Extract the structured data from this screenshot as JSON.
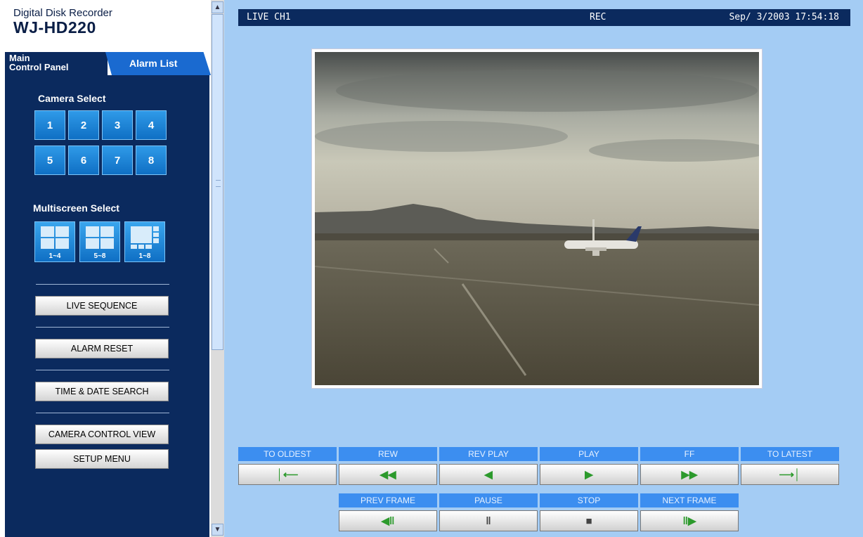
{
  "brand": {
    "subtitle": "Digital Disk Recorder",
    "model": "WJ-HD220"
  },
  "tabs": {
    "main_line1": "Main",
    "main_line2": "Control Panel",
    "alarm": "Alarm List"
  },
  "camera_select": {
    "title": "Camera Select",
    "cameras": [
      "1",
      "2",
      "3",
      "4",
      "5",
      "6",
      "7",
      "8"
    ]
  },
  "multiscreen": {
    "title": "Multiscreen Select",
    "options": [
      "1~4",
      "5~8",
      "1~8"
    ]
  },
  "menu": {
    "live_sequence": "LIVE SEQUENCE",
    "alarm_reset": "ALARM RESET",
    "time_date_search": "TIME & DATE SEARCH",
    "camera_control_view": "CAMERA CONTROL VIEW",
    "setup_menu": "SETUP MENU"
  },
  "status": {
    "channel": "LIVE CH1",
    "rec": "REC",
    "datetime": "Sep/ 3/2003 17:54:18"
  },
  "playback": {
    "to_oldest": "TO OLDEST",
    "rew": "REW",
    "rev_play": "REV PLAY",
    "play": "PLAY",
    "ff": "FF",
    "to_latest": "TO LATEST",
    "prev_frame": "PREV FRAME",
    "pause": "PAUSE",
    "stop": "STOP",
    "next_frame": "NEXT FRAME",
    "icons": {
      "to_oldest": "│⟵",
      "rew": "◀◀",
      "rev_play": "◀",
      "play": "▶",
      "ff": "▶▶",
      "to_latest": "⟶│",
      "prev_frame": "◀‖",
      "pause": "‖",
      "stop": "■",
      "next_frame": "‖▶"
    }
  },
  "colors": {
    "panel": "#0b2a5e",
    "background": "#a4ccf4",
    "accent_button": "#1a7ad6",
    "playback_label": "#3c8ef0"
  }
}
